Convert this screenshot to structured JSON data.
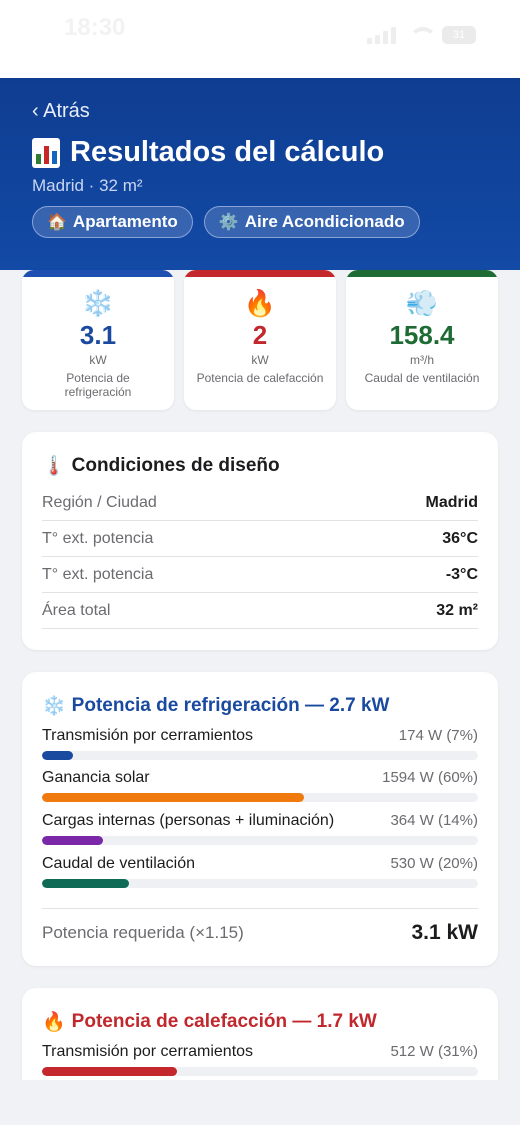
{
  "status_bar": {
    "time": "18:30",
    "battery": "31"
  },
  "header": {
    "back_label": "‹ Atrás",
    "title": "Resultados del cálculo",
    "subtitle": "Madrid · 32 m²",
    "chips": [
      {
        "icon": "🏠",
        "label": "Apartamento"
      },
      {
        "icon": "⚙️",
        "label": "Aire Acondicionado"
      }
    ]
  },
  "stats": [
    {
      "icon": "❄️",
      "value": "3.1",
      "unit": "kW",
      "label": "Potencia de refrigeración",
      "color": "#1a4aa0",
      "bar_color": "#1f4fb0"
    },
    {
      "icon": "🔥",
      "value": "2",
      "unit": "kW",
      "label": "Potencia de calefacción",
      "color": "#c0282d",
      "bar_color": "#c4282d"
    },
    {
      "icon": "💨",
      "value": "158.4",
      "unit": "m³/h",
      "label": "Caudal de ventilación",
      "color": "#1f6b35",
      "bar_color": "#1f6b35"
    }
  ],
  "design_conditions": {
    "icon": "🌡️",
    "title": "Condiciones de diseño",
    "rows": [
      {
        "label": "Región / Ciudad",
        "value": "Madrid"
      },
      {
        "label": "T° ext. potencia",
        "value": "36°C"
      },
      {
        "label": "T° ext. potencia",
        "value": "-3°C"
      },
      {
        "label": "Área total",
        "value": "32 m²"
      }
    ]
  },
  "cooling": {
    "icon": "❄️",
    "title": "Potencia de refrigeración — 2.7 kW",
    "title_color": "#1a4aa0",
    "items": [
      {
        "label": "Transmisión por cerramientos",
        "detail": "174 W (7%)",
        "percent": 7,
        "color": "#1a4aa0"
      },
      {
        "label": "Ganancia solar",
        "detail": "1594 W (60%)",
        "percent": 60,
        "color": "#f07a0e"
      },
      {
        "label": "Cargas internas (personas + iluminación)",
        "detail": "364 W (14%)",
        "percent": 14,
        "color": "#7b28a8"
      },
      {
        "label": "Caudal de ventilación",
        "detail": "530 W (20%)",
        "percent": 20,
        "color": "#0f6b55"
      }
    ],
    "total_label": "Potencia requerida (×1.15)",
    "total_value": "3.1 kW"
  },
  "heating": {
    "icon": "🔥",
    "title": "Potencia de calefacción — 1.7 kW",
    "title_color": "#c0282d",
    "items": [
      {
        "label": "Transmisión por cerramientos",
        "detail": "512 W (31%)",
        "percent": 31,
        "color": "#c4282d"
      }
    ]
  }
}
